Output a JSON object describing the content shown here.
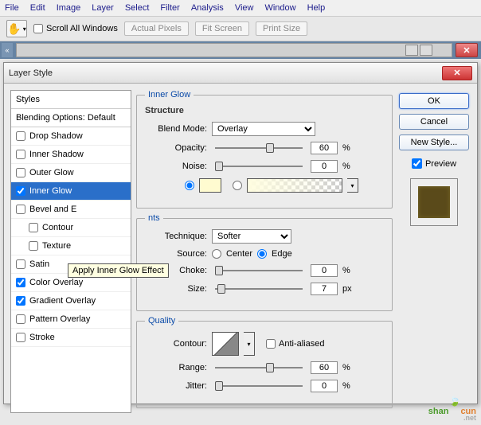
{
  "menu": [
    "File",
    "Edit",
    "Image",
    "Layer",
    "Select",
    "Filter",
    "Analysis",
    "View",
    "Window",
    "Help"
  ],
  "toolbar": {
    "scroll_all": "Scroll All Windows",
    "actual_pixels": "Actual Pixels",
    "fit_screen": "Fit Screen",
    "print_size": "Print Size"
  },
  "dialog": {
    "title": "Layer Style",
    "styles_header": "Styles",
    "blending_options": "Blending Options: Default",
    "style_items": [
      {
        "label": "Drop Shadow",
        "checked": false
      },
      {
        "label": "Inner Shadow",
        "checked": false
      },
      {
        "label": "Outer Glow",
        "checked": false
      },
      {
        "label": "Inner Glow",
        "checked": true,
        "selected": true
      },
      {
        "label": "Bevel and E",
        "checked": false
      },
      {
        "label": "Contour",
        "checked": false,
        "indent": true
      },
      {
        "label": "Texture",
        "checked": false,
        "indent": true
      },
      {
        "label": "Satin",
        "checked": false
      },
      {
        "label": "Color Overlay",
        "checked": true
      },
      {
        "label": "Gradient Overlay",
        "checked": true
      },
      {
        "label": "Pattern Overlay",
        "checked": false
      },
      {
        "label": "Stroke",
        "checked": false
      }
    ],
    "tooltip": "Apply Inner Glow Effect",
    "main_group": "Inner Glow",
    "structure": {
      "title": "Structure",
      "blend_mode_lbl": "Blend Mode:",
      "blend_mode_val": "Overlay",
      "opacity_lbl": "Opacity:",
      "opacity_val": "60",
      "noise_lbl": "Noise:",
      "noise_val": "0",
      "pct": "%",
      "color": "#fffbd0"
    },
    "elements": {
      "title": "nts",
      "technique_lbl": "Technique:",
      "technique_val": "Softer",
      "source_lbl": "Source:",
      "center": "Center",
      "edge": "Edge",
      "choke_lbl": "Choke:",
      "choke_val": "0",
      "size_lbl": "Size:",
      "size_val": "7",
      "px": "px",
      "pct": "%"
    },
    "quality": {
      "title": "Quality",
      "contour_lbl": "Contour:",
      "antialiased": "Anti-aliased",
      "range_lbl": "Range:",
      "range_val": "60",
      "jitter_lbl": "Jitter:",
      "jitter_val": "0",
      "pct": "%"
    },
    "buttons": {
      "ok": "OK",
      "cancel": "Cancel",
      "new_style": "New Style...",
      "preview": "Preview"
    }
  },
  "watermark": {
    "p1": "shan",
    "p2": "cun",
    "sub": ".net"
  }
}
